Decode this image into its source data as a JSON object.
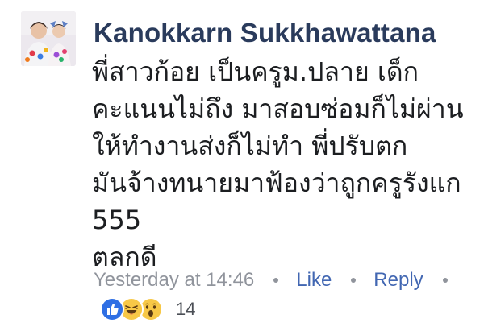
{
  "comment": {
    "author": "Kanokkarn Sukkhawattana",
    "lines": [
      "พี่สาวก้อย เป็นครูม.ปลาย เด็ก",
      "คะแนนไม่ถึง มาสอบซ่อมก็ไม่ผ่าน",
      "ให้ทำงานส่งก็ไม่ทำ พี่ปรับตก",
      "มันจ้างทนายมาฟ้องว่าถูกครูรังแก",
      "555",
      "ตลกดี"
    ],
    "timestamp": "Yesterday at 14:46",
    "like_label": "Like",
    "reply_label": "Reply",
    "reactions": {
      "icons": [
        "like-icon",
        "haha-icon",
        "wow-icon"
      ],
      "count": "14"
    }
  },
  "colors": {
    "author": "#2a3b5c",
    "link": "#4267b2",
    "meta": "#90949c",
    "like": "#2f6fe4",
    "emoji": "#f7c847"
  }
}
